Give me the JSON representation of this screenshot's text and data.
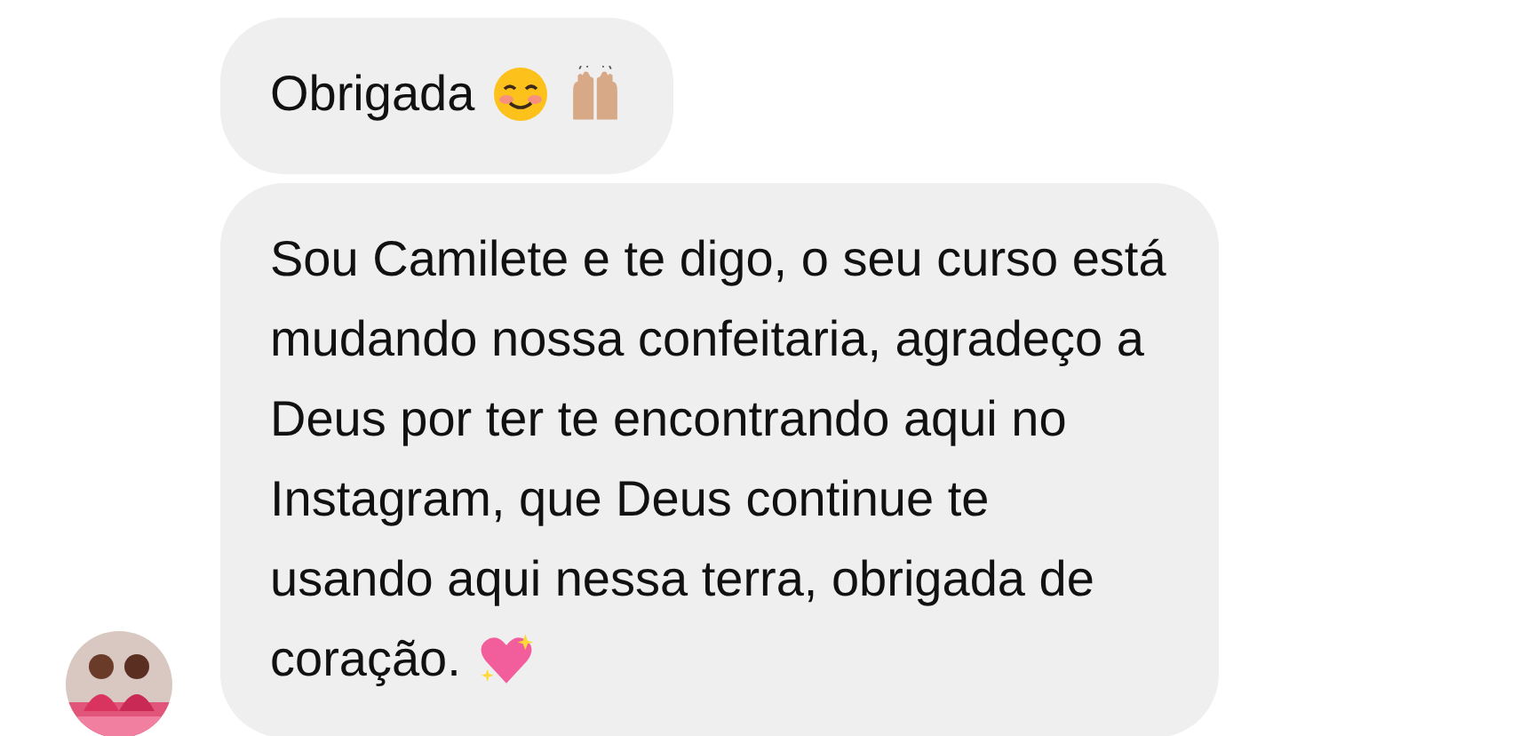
{
  "messages": [
    {
      "text_lines": [
        "Obrigada"
      ],
      "emojis": [
        {
          "kind": "smiling-face"
        },
        {
          "kind": "raised-hands"
        }
      ],
      "avatar": false
    },
    {
      "text_lines": [
        "Sou Camilete e te digo, o seu curso está",
        "mudando nossa confeitaria, agradeço a",
        "Deus por ter te encontrando aqui no",
        "Instagram, que Deus continue te",
        "usando aqui nessa terra, obrigada de",
        "coração."
      ],
      "emojis": [
        {
          "kind": "sparkling-heart"
        }
      ],
      "avatar": true
    }
  ]
}
